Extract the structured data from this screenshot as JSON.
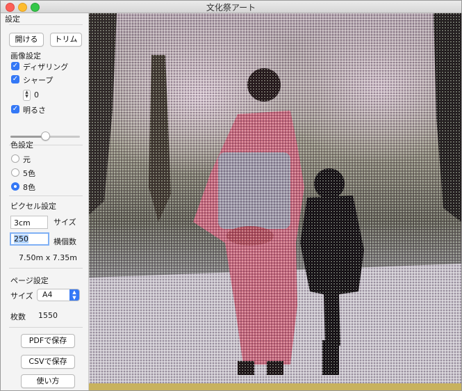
{
  "window": {
    "title": "文化祭アート"
  },
  "sidebar": {
    "header": "設定",
    "open_label": "開ける",
    "trim_label": "トリム",
    "image_settings": {
      "title": "画像設定",
      "dithering": {
        "label": "ディザリング",
        "checked": true
      },
      "sharp": {
        "label": "シャープ",
        "checked": true
      },
      "sharp_value": "0",
      "brightness": {
        "label": "明るさ",
        "checked": true
      },
      "brightness_level": 0.5
    },
    "color_settings": {
      "title": "色設定",
      "options": [
        "元",
        "5色",
        "8色"
      ],
      "selected": "8色"
    },
    "pixel_settings": {
      "title": "ピクセル設定",
      "size_value": "3cm",
      "size_label": "サイズ",
      "horizontal_value": "250",
      "horizontal_label": "横個数",
      "dimensions": "7.50m x 7.35m"
    },
    "page_settings": {
      "title": "ページ設定",
      "size_label": "サイズ",
      "size_value": "A4",
      "sheets_label": "枚数",
      "sheets_value": "1550"
    },
    "save_pdf_label": "PDFで保存",
    "save_csv_label": "CSVで保存",
    "help_label": "使い方"
  },
  "colors": {
    "accent": "#3478f6",
    "kimono": "#c8667a"
  }
}
